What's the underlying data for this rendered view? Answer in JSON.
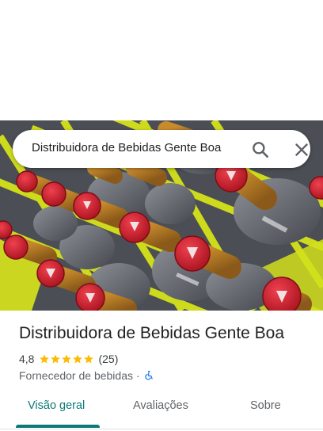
{
  "search": {
    "query": "Distribuidora de Bebidas Gente Boa",
    "search_icon": "search-icon",
    "close_icon": "close-icon"
  },
  "place": {
    "name": "Distribuidora de Bebidas Gente Boa",
    "rating": "4,8",
    "stars_filled": 5,
    "stars_total": 5,
    "review_count": "(25)",
    "category": "Fornecedor de bebidas",
    "separator": "·",
    "accessibility_icon": "wheelchair-icon"
  },
  "photo": {
    "subject": "beer-bottles-in-crates-icon"
  },
  "tabs": [
    {
      "label": "Visão geral",
      "active": true
    },
    {
      "label": "Avaliações",
      "active": false
    },
    {
      "label": "Sobre",
      "active": false
    }
  ],
  "colors": {
    "accent": "#0b7a77",
    "star": "#fbbc04",
    "accessibility": "#1a73e8"
  }
}
